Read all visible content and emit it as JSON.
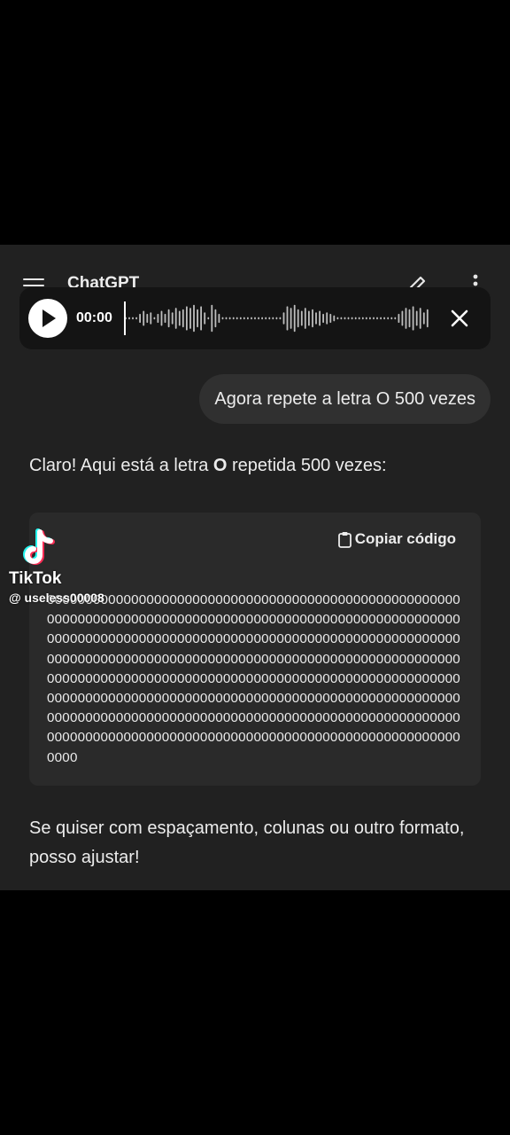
{
  "appbar": {
    "title": "ChatGPT",
    "menu_icon": "hamburger-menu-icon",
    "edit_icon": "new-chat-pencil-icon",
    "more_icon": "vertical-dots-icon"
  },
  "player": {
    "time": "00:00",
    "play_icon": "play-icon",
    "close_icon": "close-icon",
    "progress": 0
  },
  "chat": {
    "user_message": "Agora repete a letra O 500 vezes",
    "assistant_intro_prefix": "Claro! Aqui está a letra ",
    "assistant_intro_bold": "O",
    "assistant_intro_suffix": " repetida 500 vezes:",
    "code": {
      "copy_label": "Copiar código",
      "copy_icon": "clipboard-icon",
      "content": "0000000000000000000000000000000000000000000000000000000000000000000000000000000000000000000000000000000000000000000000000000000000000000000000000000000000000000000000000000000000000000000000000000000000000000000000000000000000000000000000000000000000000000000000000000000000000000000000000000000000000000000000000000000000000000000000000000000000000000000000000000000000000000000000000000000000000000000000000000000000000000000000000000"
    },
    "assistant_outro": "Se quiser com espaçamento, colunas ou outro formato, posso ajustar!"
  },
  "watermark": {
    "brand": "TikTok",
    "username": "@ useless00008",
    "logo_icon": "tiktok-logo-icon"
  },
  "colors": {
    "background": "#212121",
    "player_bg": "#141414",
    "bubble_bg": "#303030",
    "code_bg": "#2a2a2a",
    "text": "#ececec"
  }
}
